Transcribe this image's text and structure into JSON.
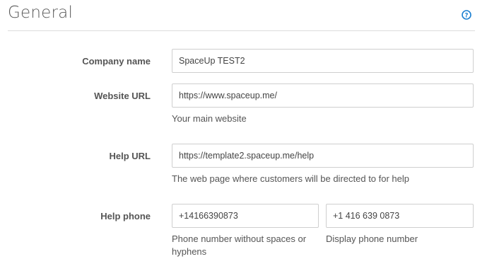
{
  "header": {
    "title": "General",
    "help_icon": "question-circle-icon",
    "accent_color": "#1a7fd1"
  },
  "form": {
    "company_name": {
      "label": "Company name",
      "value": "SpaceUp TEST2"
    },
    "website_url": {
      "label": "Website URL",
      "value": "https://www.spaceup.me/",
      "hint": "Your main website"
    },
    "help_url": {
      "label": "Help URL",
      "value": "https://template2.spaceup.me/help",
      "hint": "The web page where customers will be directed to for help"
    },
    "help_phone": {
      "label": "Help phone",
      "value": "+14166390873",
      "hint_line1": "Phone number without spaces or",
      "hint_line2": "hyphens",
      "display_value": "+1 416 639 0873",
      "display_hint": "Display phone number"
    }
  }
}
